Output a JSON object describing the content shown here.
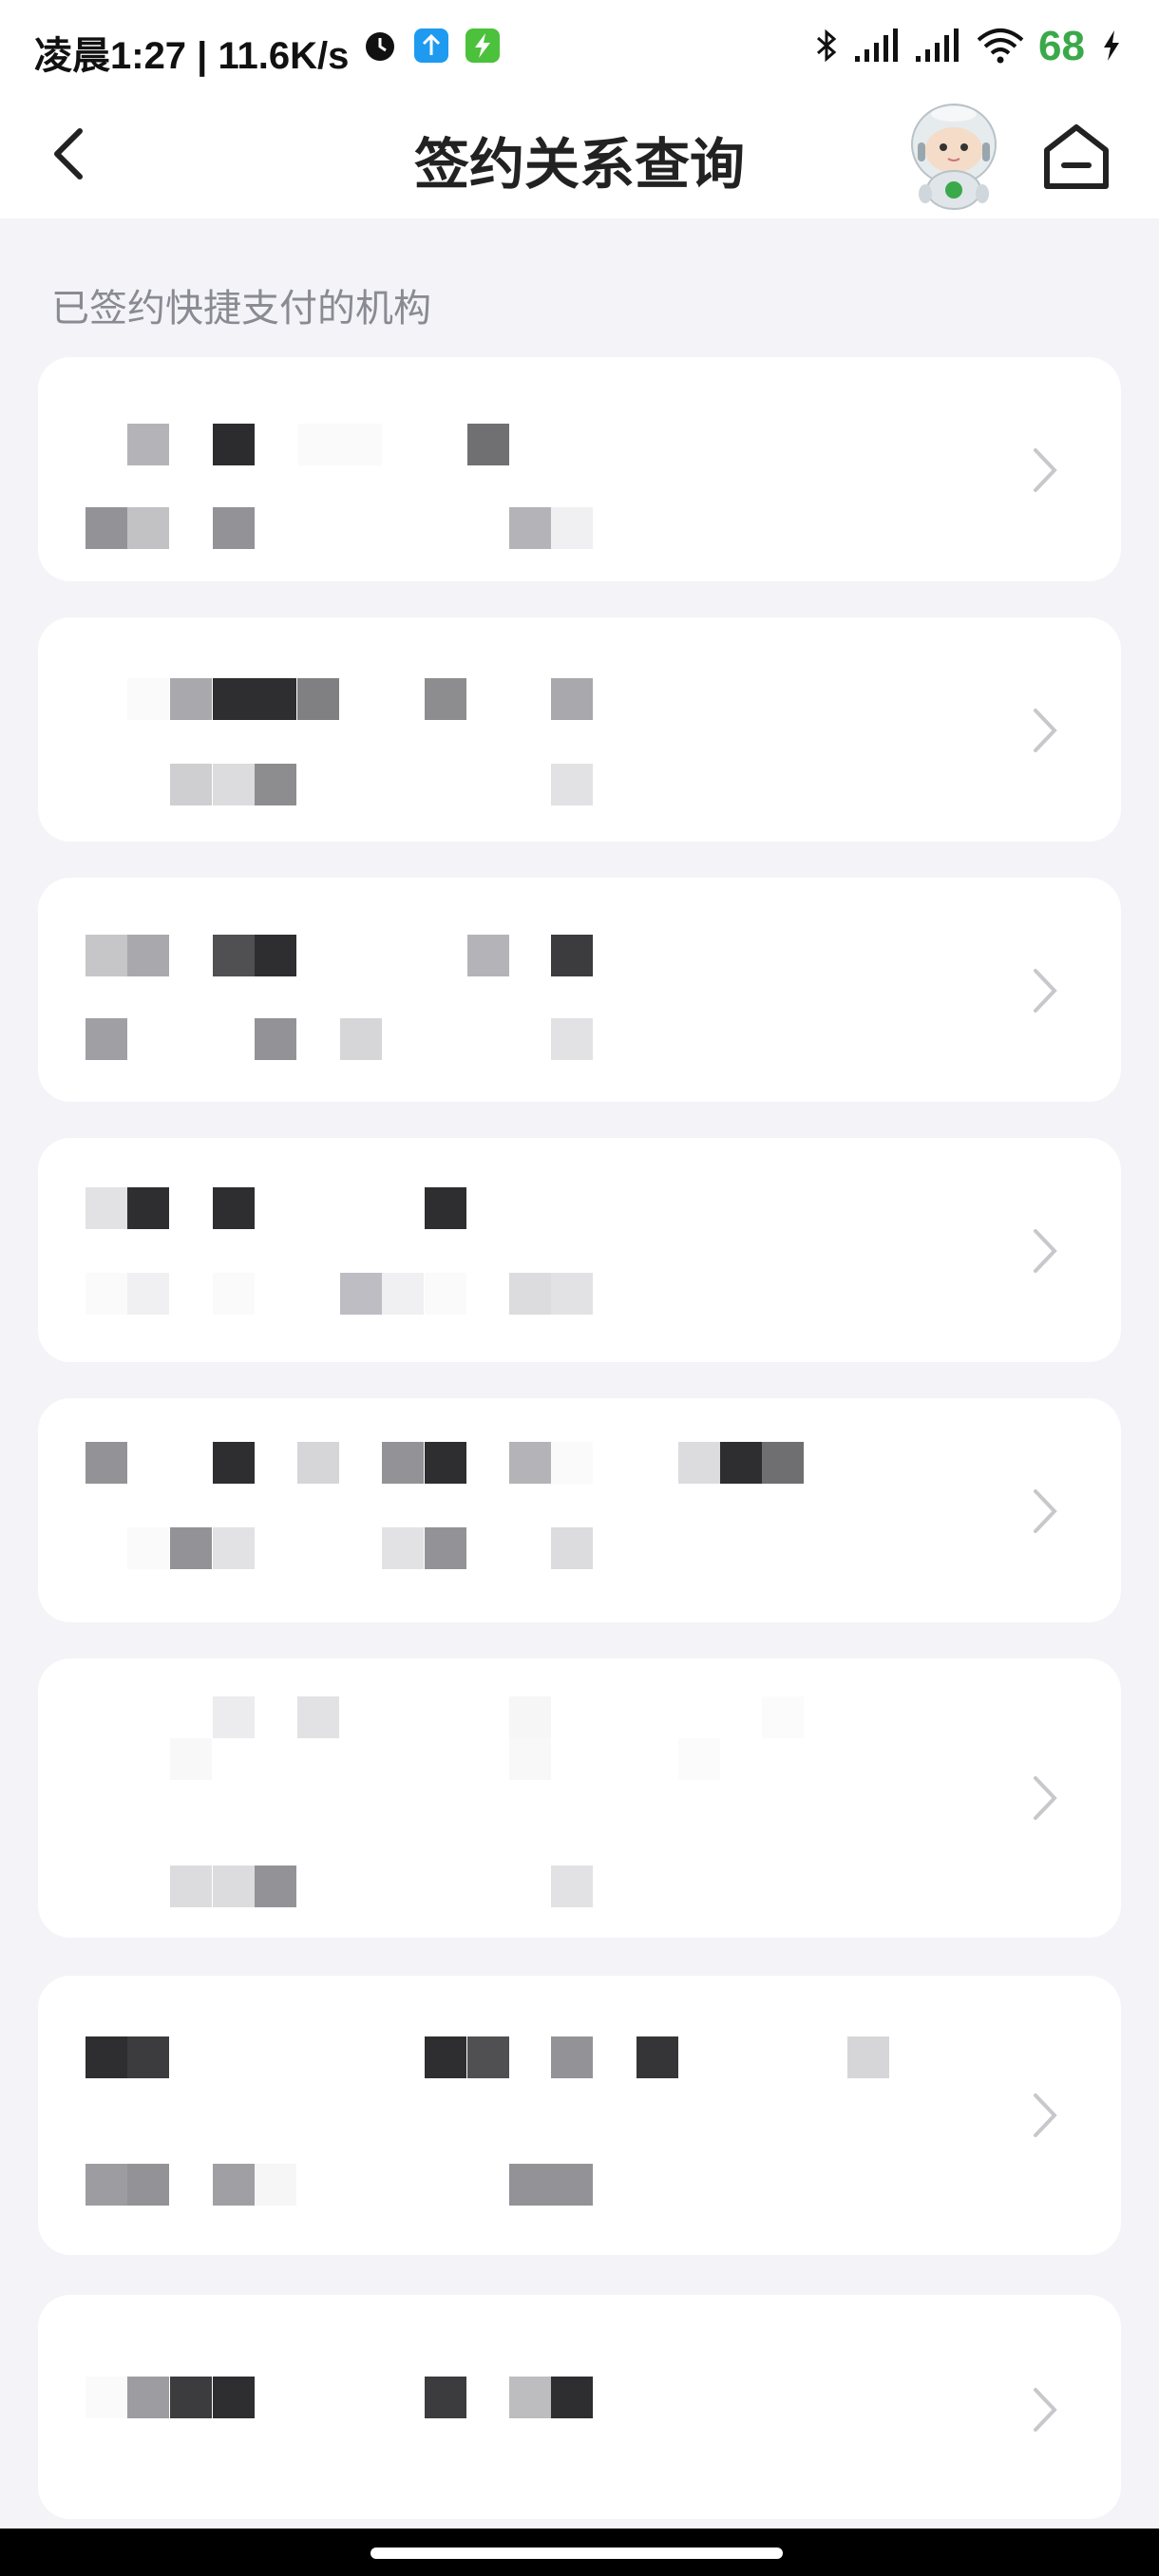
{
  "status_bar": {
    "time": "凌晨1:27 | 11.6K/s",
    "battery": "68",
    "icons": [
      "alarm-icon",
      "upload-app-icon",
      "charging-app-icon",
      "bluetooth-icon",
      "signal-icon",
      "signal-icon",
      "wifi-icon",
      "battery-charging-icon"
    ]
  },
  "header": {
    "title": "签约关系查询",
    "back_icon": "chevron-left-icon",
    "assistant_icon": "robot-assistant-icon",
    "home_icon": "home-icon"
  },
  "section": {
    "label": "已签约快捷支付的机构"
  },
  "colors": {
    "background": "#f3f3f8",
    "card": "#ffffff",
    "title": "#222222",
    "label": "#8a8a93",
    "battery": "#3aa94a"
  },
  "cards": [
    {
      "name": "signed-institution-1",
      "content": "pixelated"
    },
    {
      "name": "signed-institution-2",
      "content": "pixelated"
    },
    {
      "name": "signed-institution-3",
      "content": "pixelated"
    },
    {
      "name": "signed-institution-4",
      "content": "pixelated"
    },
    {
      "name": "signed-institution-5",
      "content": "pixelated"
    },
    {
      "name": "signed-institution-6",
      "content": "pixelated"
    },
    {
      "name": "signed-institution-7",
      "content": "pixelated"
    },
    {
      "name": "signed-institution-8",
      "content": "pixelated"
    }
  ]
}
